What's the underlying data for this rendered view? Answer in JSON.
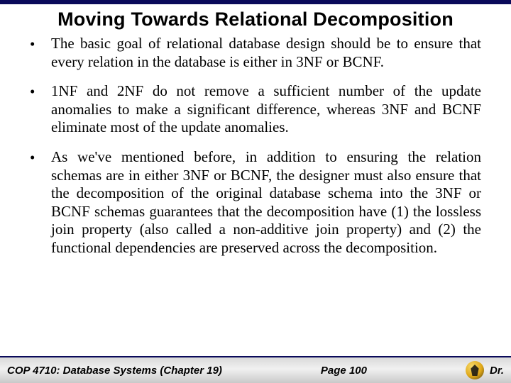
{
  "title": "Moving Towards Relational Decomposition",
  "bullets": [
    "The basic goal of relational database design should be to ensure that every relation in the database is either in 3NF or BCNF.",
    "1NF and 2NF do not remove a sufficient number of the update anomalies to make a significant difference, whereas 3NF and BCNF eliminate most of the update anomalies.",
    "As we've mentioned before, in addition to ensuring the relation schemas are in either 3NF or BCNF, the designer must also ensure that the decomposition of the original database schema into the 3NF or BCNF schemas guarantees that the decomposition have (1) the lossless join property (also called a non-additive join property) and (2) the functional dependencies are preserved across the decomposition."
  ],
  "footer": {
    "course": "COP 4710: Database Systems  (Chapter 19)",
    "page": "Page 100",
    "author": "Dr."
  }
}
